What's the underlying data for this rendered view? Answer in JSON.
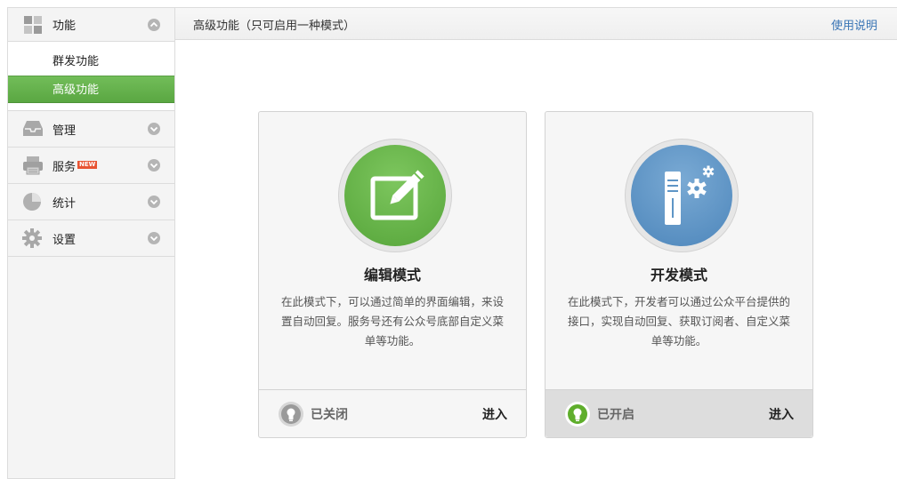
{
  "sidebar": {
    "groups": [
      {
        "label": "功能",
        "icon": "grid-icon",
        "expanded": true
      },
      {
        "label": "管理",
        "icon": "inbox-icon"
      },
      {
        "label": "服务",
        "icon": "printer-icon",
        "badge": "NEW"
      },
      {
        "label": "统计",
        "icon": "pie-chart-icon"
      },
      {
        "label": "设置",
        "icon": "gear-icon"
      }
    ],
    "submenu": [
      {
        "label": "群发功能",
        "active": false
      },
      {
        "label": "高级功能",
        "active": true
      }
    ]
  },
  "header": {
    "title": "高级功能（只可启用一种模式）",
    "help_link": "使用说明"
  },
  "cards": [
    {
      "title": "编辑模式",
      "icon": "edit-icon",
      "description": "在此模式下，可以通过简单的界面编辑，来设置自动回复。服务号还有公众号底部自定义菜单等功能。",
      "status": "已关闭",
      "enabled": false,
      "action": "进入"
    },
    {
      "title": "开发模式",
      "icon": "server-gear-icon",
      "description": "在此模式下，开发者可以通过公众平台提供的接口，实现自动回复、获取订阅者、自定义菜单等功能。",
      "status": "已开启",
      "enabled": true,
      "action": "进入"
    }
  ],
  "colors": {
    "active_green": "#62b14b",
    "edit_green": "#6bb74f",
    "dev_blue": "#5e95c6",
    "link_blue": "#3a75b5",
    "status_off": "#9a9a9a",
    "status_on": "#5fae2c"
  }
}
